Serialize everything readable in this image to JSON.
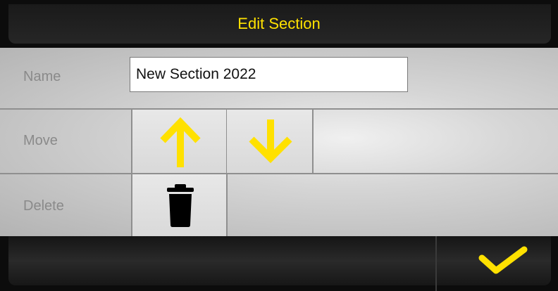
{
  "dialog": {
    "title": "Edit Section",
    "accent_color": "#ffe100"
  },
  "name_row": {
    "label": "Name",
    "value": "New Section 2022"
  },
  "move_row": {
    "label": "Move",
    "up_icon": "arrow-up-icon",
    "down_icon": "arrow-down-icon"
  },
  "delete_row": {
    "label": "Delete",
    "icon": "trash-icon"
  },
  "footer": {
    "confirm_icon": "checkmark-icon"
  }
}
